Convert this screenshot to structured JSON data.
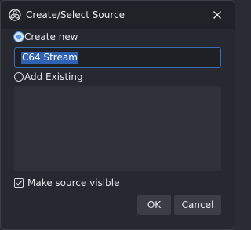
{
  "window": {
    "title": "Create/Select Source",
    "icon": "obs-logo-icon",
    "close_icon": "close-icon"
  },
  "options": {
    "create_new_label": "Create new",
    "create_new_selected": true,
    "source_name_value": "C64 Stream",
    "add_existing_label": "Add Existing",
    "add_existing_selected": false,
    "existing_sources": []
  },
  "visibility": {
    "label": "Make source visible",
    "checked": true
  },
  "buttons": {
    "ok_label": "OK",
    "cancel_label": "Cancel"
  },
  "colors": {
    "accent": "#2f62b4",
    "dialog_background": "#272930",
    "titlebar_background": "#202227",
    "button_background": "#3c3e46"
  }
}
